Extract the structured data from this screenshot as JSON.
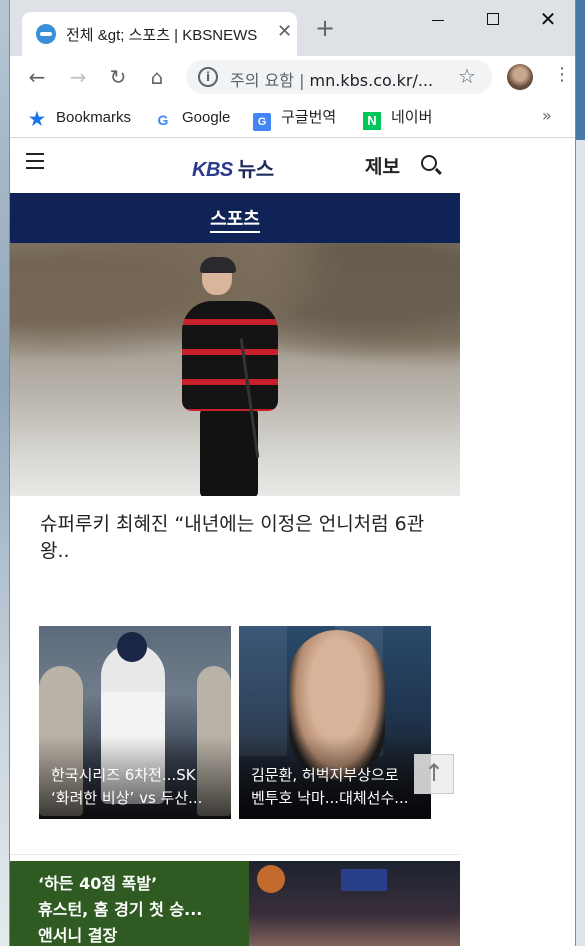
{
  "browser": {
    "tab": {
      "title": "전체 &gt; 스포츠 | KBSNEWS",
      "favicon": "globe-icon"
    },
    "new_tab_label": "+",
    "window_controls": [
      "minimize",
      "maximize",
      "close"
    ],
    "address": {
      "security_label": "주의 요함",
      "separator": "|",
      "url": "mn.kbs.co.kr/..."
    },
    "bookmarks": [
      {
        "label": "Bookmarks",
        "icon": "star-icon"
      },
      {
        "label": "Google",
        "icon": "google-icon"
      },
      {
        "label": "구글번역",
        "icon": "translate-icon"
      },
      {
        "label": "네이버",
        "icon": "naver-icon"
      }
    ],
    "bookmarks_more": "»"
  },
  "site": {
    "logo_kbs": "KBS",
    "logo_news": "뉴스",
    "report_label": "제보",
    "section_title": "스포츠"
  },
  "articles": {
    "hero_headline": "슈퍼루키 최혜진 “내년에는 이정은 언니처럼 6관왕..",
    "card_1_line1": "한국시리즈 6차전...SK",
    "card_1_line2": "‘화려한 비상’ vs 두산...",
    "card_2_line1": "김문환, 허벅지부상으로",
    "card_2_line2": "벤투호 낙마...대체선수...",
    "bottom_line1": "‘하든 40점 폭발’",
    "bottom_line2": "휴스턴, 홈 경기 첫 승...",
    "bottom_line3": "앤서니 결장"
  },
  "scroll_top_label": "↑"
}
